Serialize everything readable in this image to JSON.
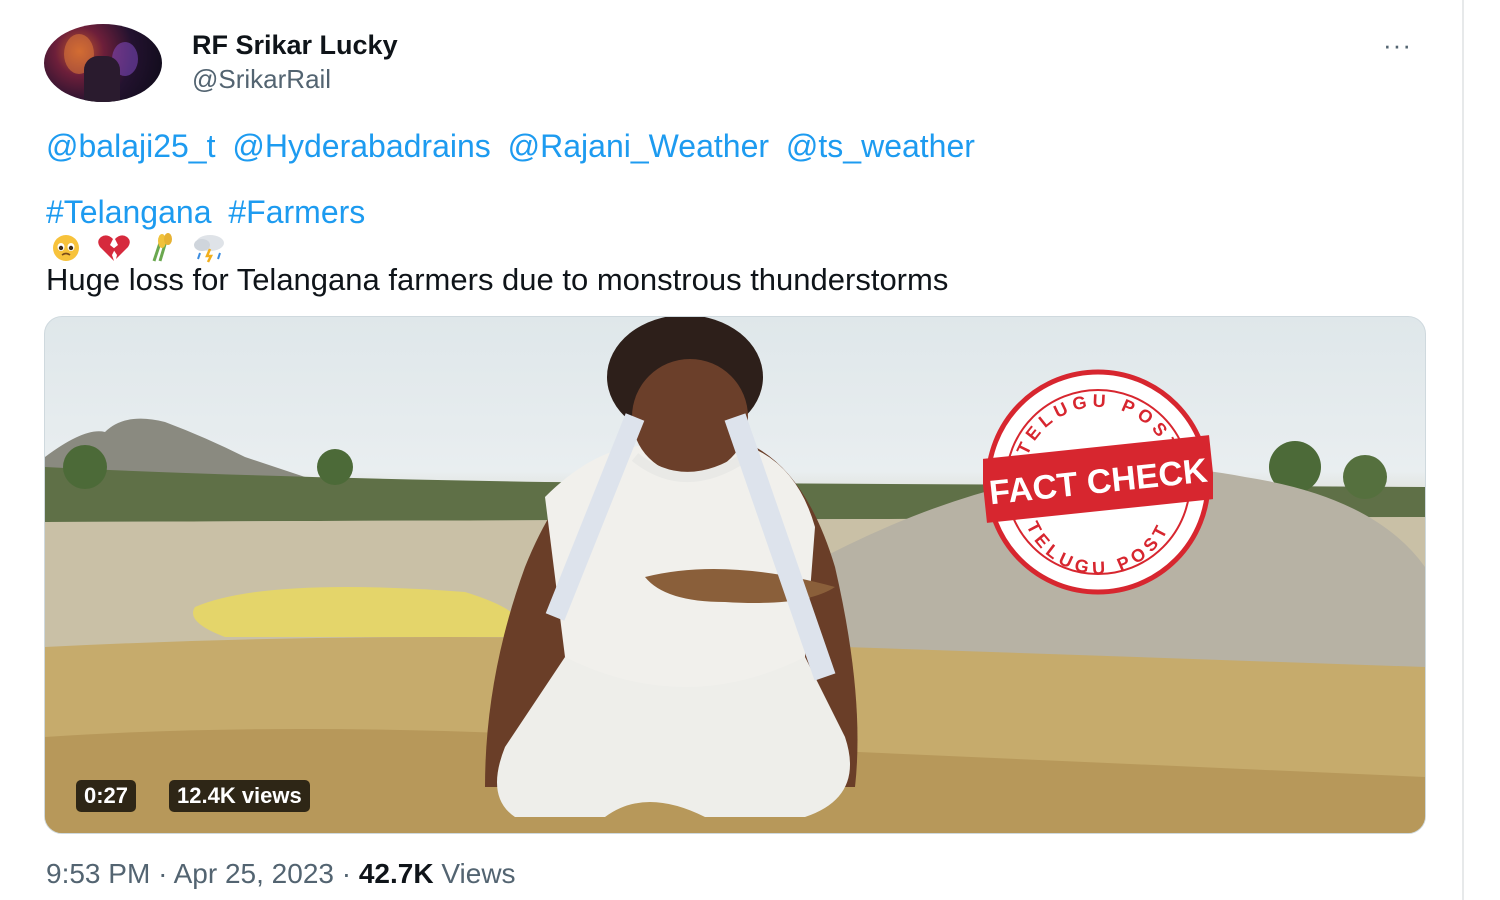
{
  "author": {
    "display_name": "RF Srikar Lucky",
    "handle": "@SrikarRail"
  },
  "more_menu": "···",
  "tweet": {
    "mentions": [
      "@balaji25_t",
      "@Hyderabadrains",
      "@Rajani_Weather",
      "@ts_weather"
    ],
    "hashtags": [
      "#Telangana",
      "#Farmers"
    ],
    "emojis": [
      "pleading-face",
      "broken-heart",
      "rice-sheaf",
      "cloud-rain-lightning"
    ],
    "text": "Huge loss for Telangana farmers due to monstrous thunderstorms"
  },
  "media": {
    "duration": "0:27",
    "views": "12.4K views",
    "stamp": {
      "top": "TELUGU POST",
      "center": "FACT CHECK",
      "bottom": "TELUGU POST",
      "color": "#d7262f"
    }
  },
  "meta": {
    "time": "9:53 PM",
    "separator": "·",
    "date": "Apr 25, 2023",
    "view_count": "42.7K",
    "view_label": "Views"
  },
  "colors": {
    "link": "#1d9bf0",
    "secondary_text": "#536471",
    "primary_text": "#0f1419"
  }
}
